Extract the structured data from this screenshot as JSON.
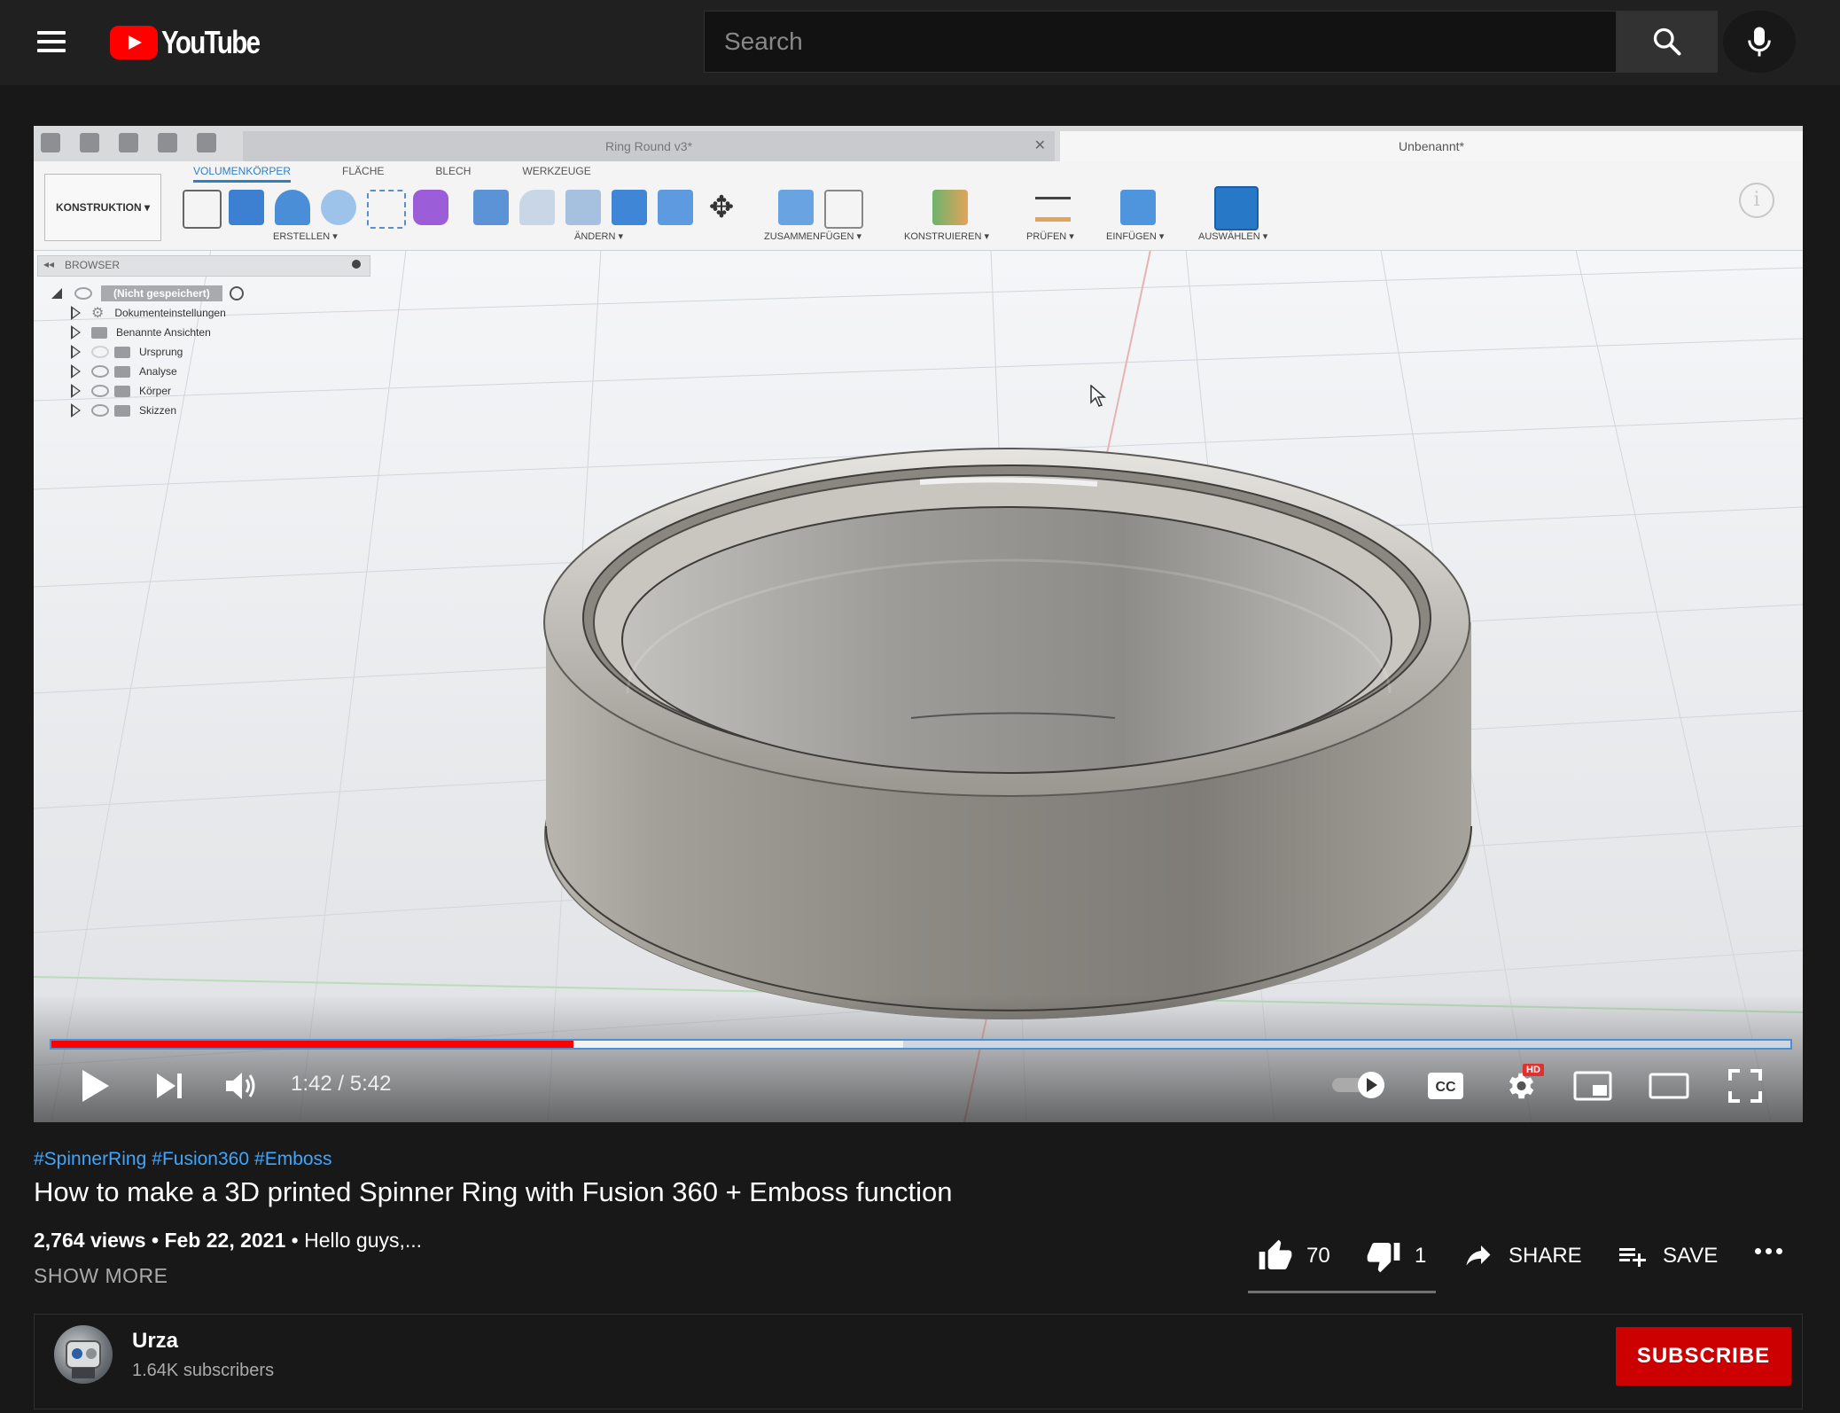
{
  "masthead": {
    "logo_text": "YouTube",
    "search_placeholder": "Search"
  },
  "fusion": {
    "tab_inactive": "Ring Round v3*",
    "tab_active": "Unbenannt*",
    "workspace": "KONSTRUKTION ▾",
    "ribbon_tabs": [
      "VOLUMENKÖRPER",
      "FLÄCHE",
      "BLECH",
      "WERKZEUGE"
    ],
    "groups": [
      "ERSTELLEN ▾",
      "ÄNDERN ▾",
      "ZUSAMMENFÜGEN ▾",
      "KONSTRUIEREN ▾",
      "PRÜFEN ▾",
      "EINFÜGEN ▾",
      "AUSWÄHLEN ▾"
    ],
    "browser_label": "BROWSER",
    "tree_root": "(Nicht gespeichert)",
    "tree_items": [
      "Dokumenteinstellungen",
      "Benannte Ansichten",
      "Ursprung",
      "Analyse",
      "Körper",
      "Skizzen"
    ]
  },
  "player": {
    "time_current": "1:42",
    "time_total": "5:42",
    "time_display": "1:42 / 5:42",
    "progress_played_fraction": 0.3,
    "progress_loaded_fraction": 0.49,
    "hd_badge": "HD",
    "autoplay_on": true
  },
  "video": {
    "hashtags": [
      "#SpinnerRing",
      "#Fusion360",
      "#Emboss"
    ],
    "title": "How to make a 3D printed Spinner Ring with Fusion 360 + Emboss function",
    "views": "2,764 views",
    "date": "Feb 22, 2021",
    "description_snippet": "Hello guys,...",
    "show_more": "SHOW MORE",
    "likes": "70",
    "dislikes": "1",
    "share_label": "SHARE",
    "save_label": "SAVE"
  },
  "channel": {
    "name": "Urza",
    "subscribers": "1.64K subscribers",
    "subscribe_label": "SUBSCRIBE"
  },
  "colors": {
    "accent": "#ff0000",
    "link": "#3ea6ff",
    "subscribe": "#cc0000",
    "background": "#181818"
  }
}
